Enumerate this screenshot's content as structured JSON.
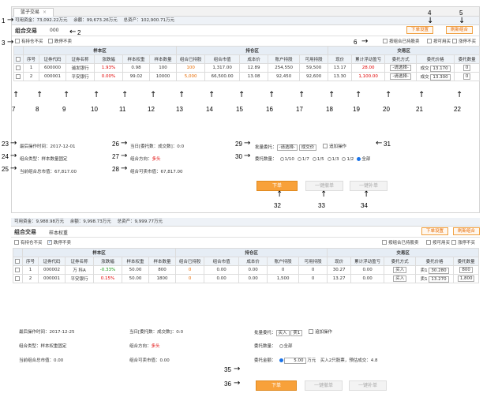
{
  "top": {
    "tab": "篮子交易",
    "fund": {
      "available": "可用资金：73,092.22万元",
      "balance": "余额：99,673.26万元",
      "total": "总资产：102,900.71万元"
    },
    "title": "组合交易",
    "portfolio_name": "000",
    "btn_order_settings": "下单设置",
    "btn_refresh": "刷新组合",
    "chk_suspended": "有持仓不买",
    "chk_limit": "跌停不卖",
    "chk_by_portfolio": "按组合已持股卖",
    "chk_by_available": "按可用买",
    "chk_by_limit": "涨停不买",
    "groups": {
      "sample": "样本区",
      "position": "持仓区",
      "trade": "交易区"
    },
    "headers": [
      "序号",
      "证券代码",
      "证券名称",
      "涨跌幅",
      "样本权重",
      "样本数量",
      "组合已持股",
      "组合市值",
      "成本价",
      "账户持股",
      "可用持股",
      "现价",
      "累计浮动盈亏",
      "委托方式",
      "委托价格",
      "委托数量"
    ],
    "rows": [
      {
        "no": "1",
        "code": "600000",
        "name": "浦发银行",
        "change": "1.93%",
        "weight": "0.98",
        "qty": "100",
        "held": "100",
        "mv": "1,317.00",
        "cost": "12.89",
        "acct": "254,550",
        "avail": "59,500",
        "price": "13.17",
        "pnl": "28.00",
        "method": "-请选择-",
        "ptype": "成交",
        "pval": "13.170",
        "oq": "0"
      },
      {
        "no": "2",
        "code": "000001",
        "name": "平安银行",
        "change": "0.00%",
        "weight": "99.02",
        "qty": "10000",
        "held": "5,000",
        "mv": "66,500.00",
        "cost": "13.08",
        "acct": "92,450",
        "avail": "92,600",
        "price": "13.30",
        "pnl": "1,100.00",
        "method": "-请选择-",
        "ptype": "成交",
        "pval": "13.300",
        "oq": "0"
      }
    ],
    "info": {
      "last_op_label": "最后操作时间：",
      "last_op": "2017-12-01",
      "type_label": "组合类型：",
      "type": "样本数量固定",
      "mv_label": "当前组合总市值：",
      "mv": "67,817.00",
      "today_label": "当日[委托数：成交数]：",
      "today": "0:0",
      "dir_label": "组合方向：",
      "dir": "多头",
      "sell_label": "组合可卖市值：",
      "sell": "67,817.00",
      "batch_label": "批量委托：",
      "batch_sel": "-请选择-",
      "batch_type": "成交价",
      "append": "追加操作",
      "qty_label": "委托数量：",
      "ratios": [
        "1/10",
        "1/7",
        "1/5",
        "1/3",
        "1/2",
        "全部"
      ]
    },
    "btn_order": "下单",
    "btn_oneclick_cancel": "一键撤单",
    "btn_oneclick_fill": "一键补单"
  },
  "bottom": {
    "fund": {
      "available": "可用资金：9,988.98万元",
      "balance": "余额：9,998.73万元",
      "total": "总资产：9,999.77万元"
    },
    "title": "组合交易",
    "portfolio_name": "样本权重",
    "btn_order_settings": "下单设置",
    "btn_refresh": "刷新组合",
    "chk_suspended": "有持仓不买",
    "chk_limit": "跌停不卖",
    "chk_by_portfolio": "按组合已持股卖",
    "chk_by_available": "按可用买",
    "chk_by_limit": "涨停不买",
    "groups": {
      "sample": "样本区",
      "position": "持仓区",
      "trade": "交易区"
    },
    "headers": [
      "序号",
      "证券代码",
      "证券名称",
      "涨跌幅",
      "样本权重",
      "样本数量",
      "组合已持股",
      "组合市值",
      "成本价",
      "账户持股",
      "可用持股",
      "现价",
      "累计浮动盈亏",
      "委托方式",
      "委托价格",
      "委托数量"
    ],
    "rows": [
      {
        "no": "1",
        "code": "000002",
        "name": "万 科A",
        "change": "-0.33%",
        "weight": "50.00",
        "qty": "800",
        "held": "0",
        "mv": "0.00",
        "cost": "0.00",
        "acct": "0",
        "avail": "0",
        "price": "30.27",
        "pnl": "0.00",
        "method": "买入",
        "ptype": "卖1",
        "pval": "30.280",
        "oq": "800"
      },
      {
        "no": "2",
        "code": "000001",
        "name": "平安银行",
        "change": "0.15%",
        "weight": "50.00",
        "qty": "1800",
        "held": "0",
        "mv": "0.00",
        "cost": "0.00",
        "acct": "1,500",
        "avail": "0",
        "price": "13.27",
        "pnl": "0.00",
        "method": "买入",
        "ptype": "卖1",
        "pval": "13.270",
        "oq": "1,800"
      }
    ],
    "info": {
      "last_op_label": "最后操作时间：",
      "last_op": "2017-12-25",
      "type_label": "组合类型：",
      "type": "样本权重固定",
      "mv_label": "当前组合总市值：",
      "mv": "0.00",
      "today_label": "当日[委托数：成交数]：",
      "today": "0:0",
      "dir_label": "组合方向：",
      "dir": "多头",
      "sell_label": "组合可卖市值：",
      "sell": "0.00",
      "batch_label": "批量委托：",
      "batch_sel": "买入",
      "batch_type": "卖1",
      "append": "追加操作",
      "qty_label": "委托数量：",
      "qty_all": "全部",
      "amount_label": "委托金额：",
      "amount": "5.00",
      "amount_unit": "万元",
      "amount_note": "买入2只股票，预估成交：4.8"
    },
    "btn_order": "下单",
    "btn_oneclick_cancel": "一键撤单",
    "btn_oneclick_fill": "一键补单"
  },
  "annotations": [
    "1",
    "2",
    "3",
    "4",
    "5",
    "6",
    "7",
    "8",
    "9",
    "10",
    "11",
    "12",
    "13",
    "14",
    "15",
    "16",
    "17",
    "18",
    "19",
    "20",
    "21",
    "22",
    "23",
    "24",
    "25",
    "26",
    "27",
    "28",
    "29",
    "30",
    "31",
    "32",
    "33",
    "34",
    "35",
    "36"
  ]
}
